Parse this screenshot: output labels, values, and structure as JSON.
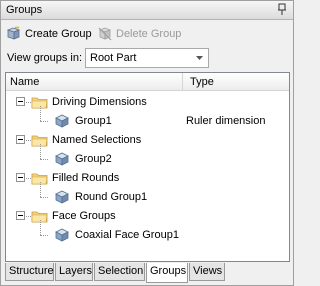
{
  "panel": {
    "title": "Groups"
  },
  "toolbar": {
    "create_label": "Create Group",
    "delete_label": "Delete Group"
  },
  "view_groups": {
    "label": "View groups in:",
    "selected": "Root Part"
  },
  "columns": {
    "name": "Name",
    "type": "Type"
  },
  "tree": [
    {
      "label": "Driving Dimensions",
      "children": [
        {
          "label": "Group1",
          "type": "Ruler dimension"
        }
      ]
    },
    {
      "label": "Named Selections",
      "children": [
        {
          "label": "Group2",
          "type": ""
        }
      ]
    },
    {
      "label": "Filled Rounds",
      "children": [
        {
          "label": "Round Group1",
          "type": ""
        }
      ]
    },
    {
      "label": "Face Groups",
      "children": [
        {
          "label": "Coaxial Face Group1",
          "type": ""
        }
      ]
    }
  ],
  "tabs": [
    "Structure",
    "Layers",
    "Selection",
    "Groups",
    "Views"
  ],
  "active_tab": "Groups",
  "colors": {
    "folder": "#f5d27a",
    "folder_edge": "#c8a040",
    "group_icon": "#8aa6c8"
  }
}
